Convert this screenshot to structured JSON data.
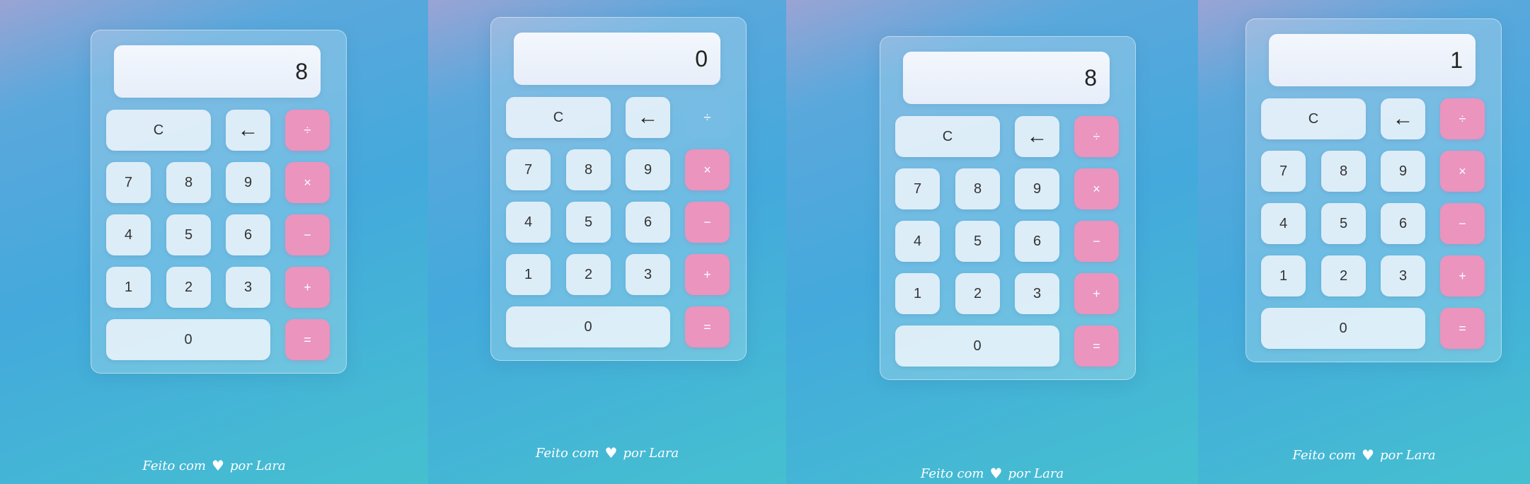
{
  "calculators": [
    {
      "display": "8",
      "divide_faded": false
    },
    {
      "display": "0",
      "divide_faded": true
    },
    {
      "display": "8",
      "divide_faded": false
    },
    {
      "display": "1",
      "divide_faded": false
    }
  ],
  "keys": {
    "clear": "C",
    "backspace": "←",
    "divide": "÷",
    "multiply": "×",
    "minus": "−",
    "plus": "+",
    "equals": "=",
    "d0": "0",
    "d1": "1",
    "d2": "2",
    "d3": "3",
    "d4": "4",
    "d5": "5",
    "d6": "6",
    "d7": "7",
    "d8": "8",
    "d9": "9"
  },
  "footer": {
    "prefix": "Feito com",
    "suffix": "por Lara",
    "icon": "heart-icon",
    "icon_color": "#ffffff"
  },
  "colors": {
    "operator": "#ea94be",
    "key_bg": "#ecf4fa",
    "background_top": "#9aa4d4",
    "background_mid": "#44a9dc",
    "background_bottom": "#45c0d0"
  }
}
